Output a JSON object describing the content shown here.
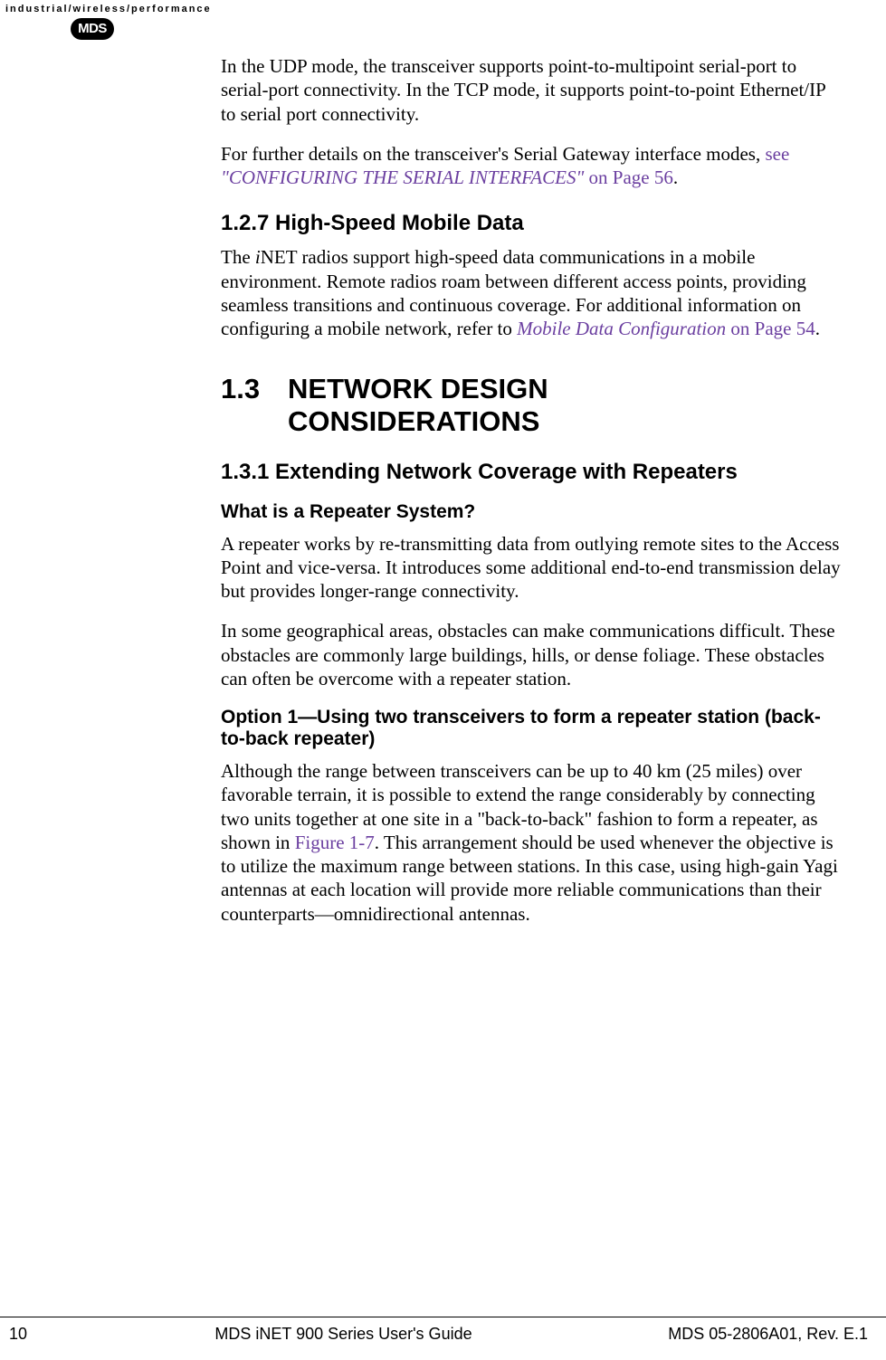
{
  "header": {
    "tagline": "industrial/wireless/performance",
    "logo_text": "MDS"
  },
  "content": {
    "p1": "In the UDP mode, the transceiver supports point-to-multipoint serial-port to serial-port connectivity. In the TCP mode, it supports point-to-point Ethernet/IP to serial port connectivity.",
    "p2_pre": "For further details on the transceiver's Serial Gateway interface modes, ",
    "p2_link_see": "see ",
    "p2_link_italic": "\"CONFIGURING THE SERIAL INTERFACES\"",
    "p2_link_post": " on Page 56",
    "p2_end": ".",
    "h_1_2_7": "1.2.7 High-Speed Mobile Data",
    "p3_pre": "The ",
    "p3_italic": "i",
    "p3_mid": "NET radios support high-speed data communications in a mobile environment. Remote radios roam between different access points, providing seamless transitions and continuous coverage. For additional information on configuring a mobile network, refer to ",
    "p3_link_italic": "Mobile Data Configuration",
    "p3_link_post": " on Page 54",
    "p3_end": ".",
    "h_1_3_num": "1.3",
    "h_1_3_title": "NETWORK DESIGN CONSIDERATIONS",
    "h_1_3_1": "1.3.1 Extending Network Coverage with Repeaters",
    "sub1": "What is a Repeater System?",
    "p4": "A repeater works by re-transmitting data from outlying remote sites to the Access Point and vice-versa. It introduces some additional end-to-end transmission delay but provides longer-range connectivity.",
    "p5": "In some geographical areas, obstacles can make communications difficult. These obstacles are commonly large buildings, hills, or dense foliage. These obstacles can often be overcome with a repeater station.",
    "sub2": "Option 1—Using two transceivers to form a repeater station (back-to-back repeater)",
    "p6_pre": "Although the range between transceivers can be up to 40 km (25 miles) over favorable terrain, it is possible to extend the range considerably by connecting two units together at one site in a \"back-to-back\" fashion to form a repeater, as shown in ",
    "p6_link": "Figure 1-7",
    "p6_post": ". This arrangement should be used whenever the objective is to utilize the maximum range between stations. In this case, using high-gain Yagi antennas at each location will provide more reliable communications than their counterparts—omnidirectional antennas."
  },
  "footer": {
    "page_num": "10",
    "center": "MDS iNET 900 Series User's Guide",
    "right": "MDS 05-2806A01, Rev. E.1"
  }
}
